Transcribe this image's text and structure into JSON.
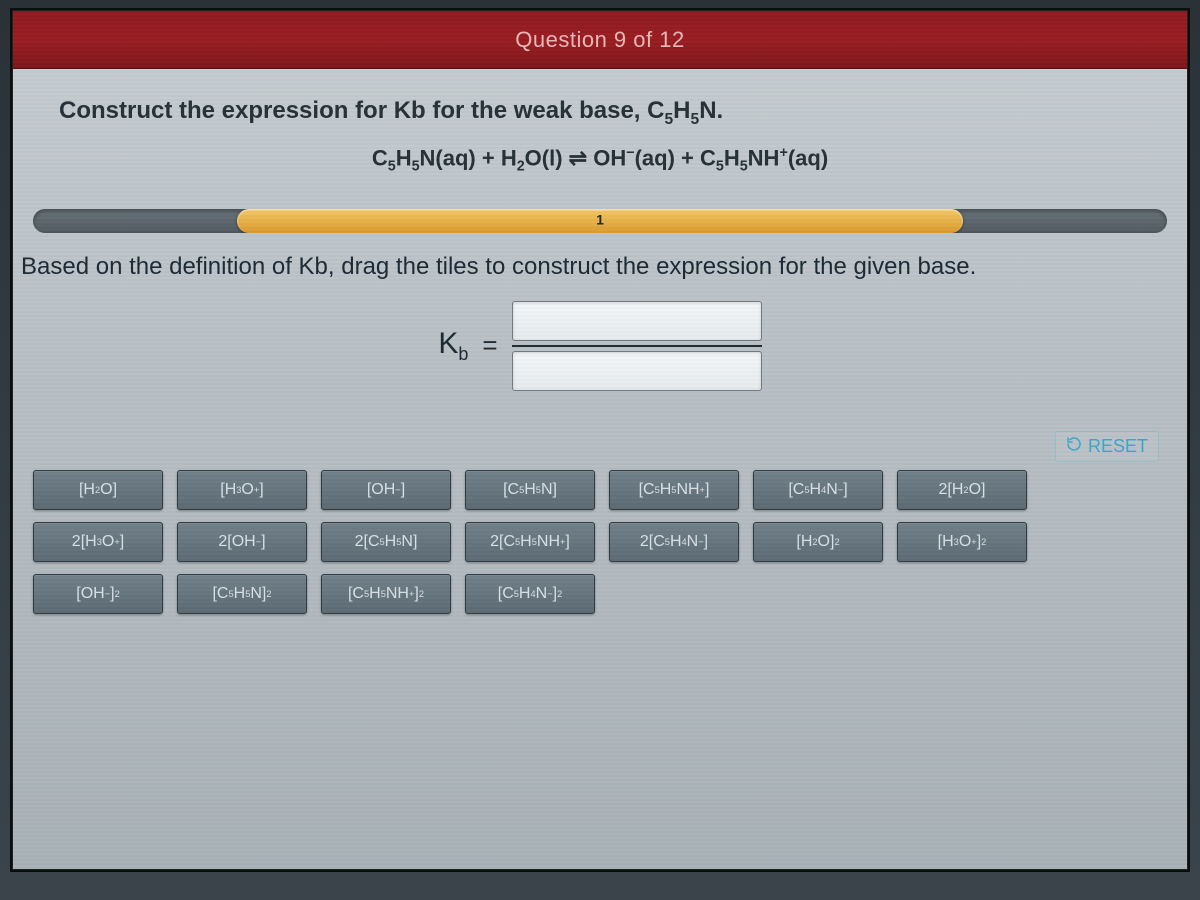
{
  "header": {
    "title": "Question 9 of 12"
  },
  "prompt": {
    "line1_html": "Construct the expression for Kb for the weak base, C<span class='sub'>5</span>H<span class='sub'>5</span>N.",
    "equation_html": "C<span class='sub'>5</span>H<span class='sub'>5</span>N(aq) + H<span class='sub'>2</span>O(l) ⇌ OH<span class='sup'>−</span>(aq) + C<span class='sub'>5</span>H<span class='sub'>5</span>NH<span class='sup'>+</span>(aq)"
  },
  "progress": {
    "label": "1"
  },
  "instruction": "Based on the definition of Kb, drag the tiles to construct the expression for the given base.",
  "kb": {
    "label_html": "K<span class='ksub'>b</span>",
    "equals": "="
  },
  "reset": {
    "label": "RESET"
  },
  "tiles": [
    {
      "id": "h2o",
      "html": "[H<span class='sub'>2</span>O]"
    },
    {
      "id": "h3o+",
      "html": "[H<span class='sub'>3</span>O<span class='sup'>+</span>]"
    },
    {
      "id": "oh-",
      "html": "[OH<span class='sup'>−</span>]"
    },
    {
      "id": "c5h5n",
      "html": "[C<span class='sub'>5</span>H<span class='sub'>5</span>N]"
    },
    {
      "id": "c5h5nh+",
      "html": "[C<span class='sub'>5</span>H<span class='sub'>5</span>NH<span class='sup'>+</span>]"
    },
    {
      "id": "c5h4n-",
      "html": "[C<span class='sub'>5</span>H<span class='sub'>4</span>N<span class='sup'>−</span>]"
    },
    {
      "id": "2h2o",
      "html": "2[H<span class='sub'>2</span>O]"
    },
    {
      "id": "2h3o+",
      "html": "2[H<span class='sub'>3</span>O<span class='sup'>+</span>]"
    },
    {
      "id": "2oh-",
      "html": "2[OH<span class='sup'>−</span>]"
    },
    {
      "id": "2c5h5n",
      "html": "2[C<span class='sub'>5</span>H<span class='sub'>5</span>N]"
    },
    {
      "id": "2c5h5nh+",
      "html": "2[C<span class='sub'>5</span>H<span class='sub'>5</span>NH<span class='sup'>+</span>]"
    },
    {
      "id": "2c5h4n-",
      "html": "2[C<span class='sub'>5</span>H<span class='sub'>4</span>N<span class='sup'>−</span>]"
    },
    {
      "id": "h2o-sq",
      "html": "[H<span class='sub'>2</span>O]<span class='sup'>2</span>"
    },
    {
      "id": "h3o+-sq",
      "html": "[H<span class='sub'>3</span>O<span class='sup'>+</span>]<span class='sup'>2</span>"
    },
    {
      "id": "oh--sq",
      "html": "[OH<span class='sup'>−</span>]<span class='sup'>2</span>"
    },
    {
      "id": "c5h5n-sq",
      "html": "[C<span class='sub'>5</span>H<span class='sub'>5</span>N]<span class='sup'>2</span>"
    },
    {
      "id": "c5h5nh+-sq",
      "html": "[C<span class='sub'>5</span>H<span class='sub'>5</span>NH<span class='sup'>+</span>]<span class='sup'>2</span>"
    },
    {
      "id": "c5h4n--sq",
      "html": "[C<span class='sub'>5</span>H<span class='sub'>4</span>N<span class='sup'>−</span>]<span class='sup'>2</span>"
    }
  ]
}
